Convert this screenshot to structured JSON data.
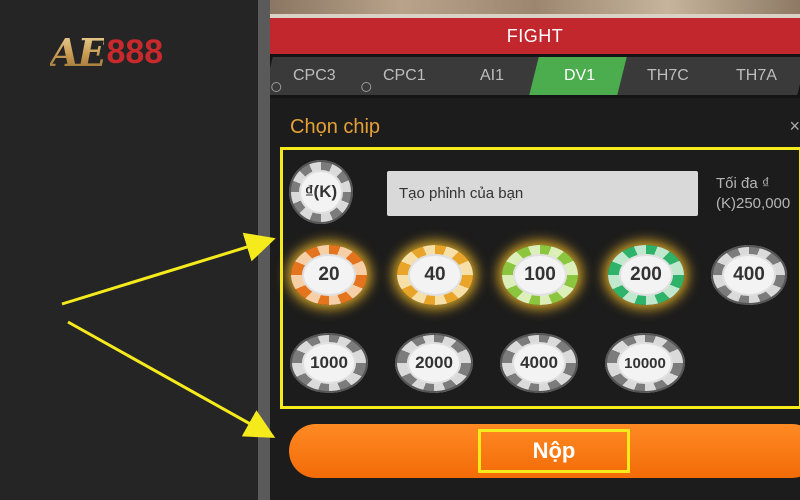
{
  "logo": {
    "ae": "AE",
    "num": "888"
  },
  "game": {
    "fight_label": "FIGHT",
    "tabs": [
      {
        "label": "CPC3",
        "clock": true,
        "active": false
      },
      {
        "label": "CPC1",
        "clock": true,
        "active": false
      },
      {
        "label": "AI1",
        "clock": false,
        "active": false
      },
      {
        "label": "DV1",
        "clock": false,
        "active": true
      },
      {
        "label": "TH7C",
        "clock": false,
        "active": false
      },
      {
        "label": "TH7A",
        "clock": false,
        "active": false
      }
    ]
  },
  "chip_panel": {
    "title": "Chọn chip",
    "close_glyph": "×",
    "custom_chip_label": "₫(K)",
    "custom_input_placeholder": "Tạo phỉnh của bạn",
    "max_label_line1": "Tối đa ₫",
    "max_label_line2": "(K)250,000",
    "chips": [
      {
        "value": "20",
        "color": "orange",
        "selected": true
      },
      {
        "value": "40",
        "color": "yellow",
        "selected": true
      },
      {
        "value": "100",
        "color": "lime",
        "selected": true
      },
      {
        "value": "200",
        "color": "green",
        "selected": true
      },
      {
        "value": "400",
        "color": "gray",
        "selected": false
      },
      {
        "value": "1000",
        "color": "gray",
        "selected": false
      },
      {
        "value": "2000",
        "color": "gray",
        "selected": false
      },
      {
        "value": "4000",
        "color": "gray",
        "selected": false
      },
      {
        "value": "10000",
        "color": "gray",
        "selected": false
      }
    ],
    "submit_label": "Nộp"
  },
  "colors": {
    "fight_bar": "#c2272d",
    "active_tab": "#4cad4e",
    "title": "#e5a036",
    "highlight": "#f5ea1c",
    "submit": "#f26b07"
  }
}
